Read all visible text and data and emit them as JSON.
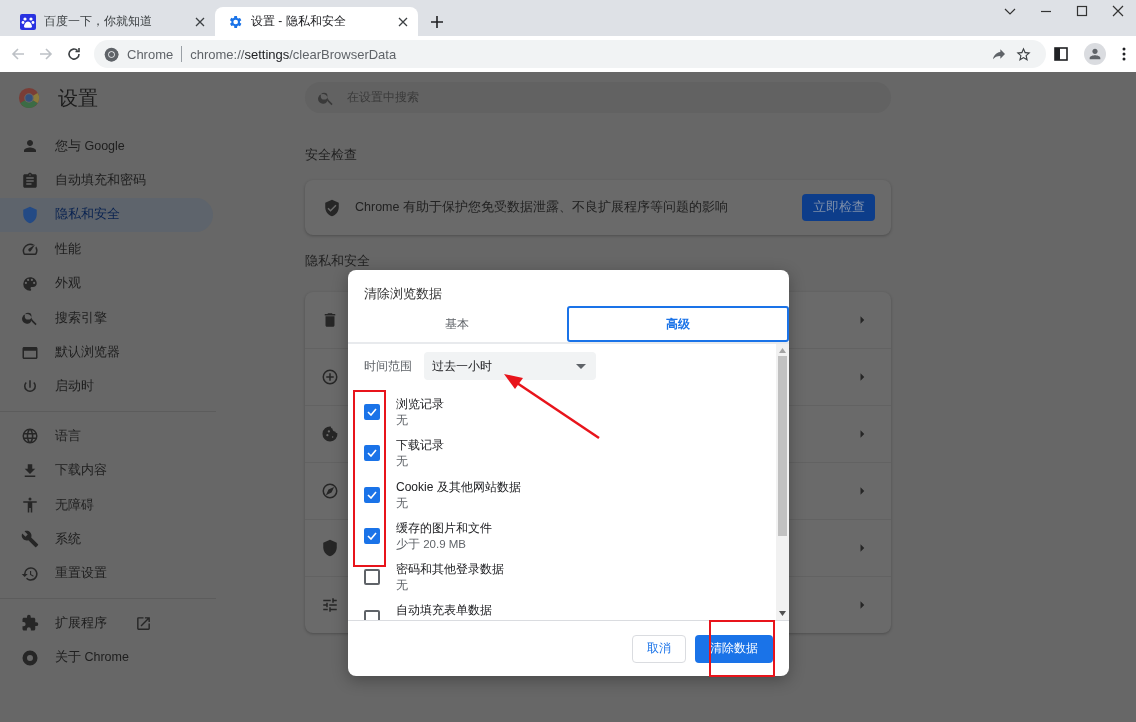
{
  "browser": {
    "tabs": [
      {
        "title": "百度一下，你就知道",
        "selected": false
      },
      {
        "title": "设置 - 隐私和安全",
        "selected": true
      }
    ],
    "address_bar": {
      "site_label": "Chrome",
      "url": "chrome://**settings**/clearBrowserData"
    }
  },
  "settings": {
    "title": "设置",
    "search": {
      "placeholder": "在设置中搜索"
    },
    "sidebar": {
      "groups": [
        {
          "items": [
            {
              "label": "您与 Google",
              "selected": false,
              "external_link": false
            },
            {
              "label": "自动填充和密码",
              "selected": false,
              "external_link": false
            },
            {
              "label": "隐私和安全",
              "selected": true,
              "external_link": false
            },
            {
              "label": "性能",
              "selected": false,
              "external_link": false
            },
            {
              "label": "外观",
              "selected": false,
              "external_link": false
            },
            {
              "label": "搜索引擎",
              "selected": false,
              "external_link": false
            },
            {
              "label": "默认浏览器",
              "selected": false,
              "external_link": false
            },
            {
              "label": "启动时",
              "selected": false,
              "external_link": false
            }
          ]
        },
        {
          "items": [
            {
              "label": "语言",
              "selected": false,
              "external_link": false
            },
            {
              "label": "下载内容",
              "selected": false,
              "external_link": false
            },
            {
              "label": "无障碍",
              "selected": false,
              "external_link": false
            },
            {
              "label": "系统",
              "selected": false,
              "external_link": false
            },
            {
              "label": "重置设置",
              "selected": false,
              "external_link": false
            }
          ]
        },
        {
          "items": [
            {
              "label": "扩展程序",
              "selected": false,
              "external_link": true
            },
            {
              "label": "关于 Chrome",
              "selected": false,
              "external_link": false
            }
          ]
        }
      ]
    },
    "safety_check": {
      "heading": "安全检查",
      "text": "Chrome 有助于保护您免受数据泄露、不良扩展程序等问题的影响",
      "button": "立即检查"
    },
    "privacy": {
      "heading": "隐私和安全"
    }
  },
  "dialog": {
    "title": "清除浏览数据",
    "tabs": [
      {
        "label": "基本",
        "selected": false
      },
      {
        "label": "高级",
        "selected": true
      }
    ],
    "time_range": {
      "label": "时间范围",
      "value": "过去一小时"
    },
    "items": [
      {
        "label": "浏览记录",
        "detail": "无",
        "checked": true
      },
      {
        "label": "下载记录",
        "detail": "无",
        "checked": true
      },
      {
        "label": "Cookie 及其他网站数据",
        "detail": "无",
        "checked": true
      },
      {
        "label": "缓存的图片和文件",
        "detail": "少于 20.9 MB",
        "checked": true
      },
      {
        "label": "密码和其他登录数据",
        "detail": "无",
        "checked": false
      },
      {
        "label": "自动填充表单数据",
        "checked": false
      }
    ],
    "buttons": [
      {
        "label": "取消",
        "kind": "secondary"
      },
      {
        "label": "清除数据",
        "kind": "primary"
      }
    ]
  }
}
